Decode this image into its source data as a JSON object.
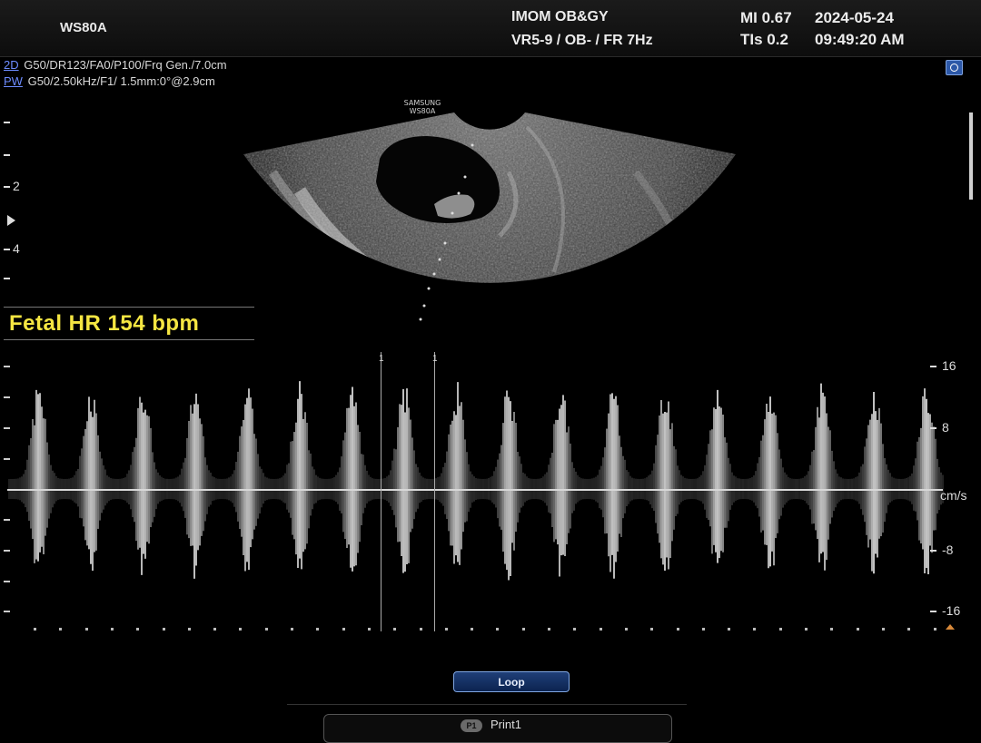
{
  "header": {
    "device": "WS80A",
    "institution": "IMOM OB&GY",
    "preset": "VR5-9 / OB- / FR 7Hz",
    "mi": "MI  0.67",
    "tis": "TIs 0.2",
    "date": "2024-05-24",
    "time": "09:49:20 AM"
  },
  "params": {
    "mode_2d": "2D",
    "line_2d": "G50/DR123/FA0/P100/Frq Gen./7.0cm",
    "mode_pw": "PW",
    "line_pw": "G50/2.50kHz/F1/ 1.5mm:0°@2.9cm"
  },
  "probe_label": [
    "SAMSUNG",
    "WS80A"
  ],
  "depth_labels": [
    "2",
    "4"
  ],
  "measurement": {
    "fetal_hr": "Fetal HR 154 bpm"
  },
  "doppler": {
    "velocity_labels": [
      "16",
      "8",
      "cm/s",
      "-8",
      "-16"
    ],
    "unit": "cm/s",
    "cursor_labels": [
      "1",
      "1"
    ]
  },
  "controls": {
    "loop_label": "Loop",
    "print_key": "P1",
    "print_label": "Print1"
  },
  "colors": {
    "measurement_text": "#f5e642",
    "mode_label": "#6d8cff",
    "accent_button": "#1f3f78"
  }
}
